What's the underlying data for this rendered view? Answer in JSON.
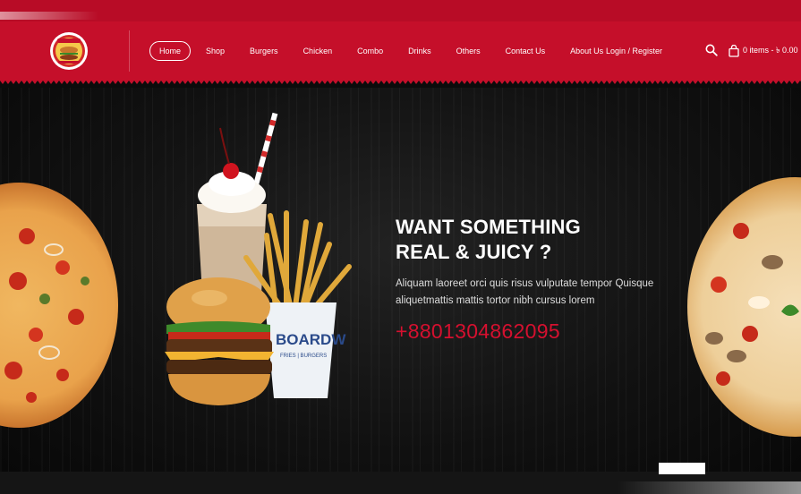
{
  "header": {
    "nav": [
      {
        "label": "Home",
        "active": true
      },
      {
        "label": "Shop"
      },
      {
        "label": "Burgers"
      },
      {
        "label": "Chicken"
      },
      {
        "label": "Combo"
      },
      {
        "label": "Drinks"
      },
      {
        "label": "Others"
      },
      {
        "label": "Contact Us"
      },
      {
        "label": "About Us"
      }
    ],
    "login_label": "Login / Register",
    "cart_label": "0 items - ৳ 0.00",
    "search_icon": "search-icon",
    "cart_icon": "shopping-bag-icon"
  },
  "hero": {
    "headline_line1": "WANT SOMETHING",
    "headline_line2": "REAL & JUICY ?",
    "description": "Aliquam laoreet orci quis risus vulputate tempor Quisque aliquetmattis mattis tortor nibh cursus lorem",
    "phone": "+8801304862095",
    "cup_text": "BOARDW",
    "cup_subtext": "FRIES | BURGERS"
  },
  "colors": {
    "brand_red": "#c50f2a",
    "phone_red": "#d5102f",
    "hero_background": "#0b0b0b"
  }
}
